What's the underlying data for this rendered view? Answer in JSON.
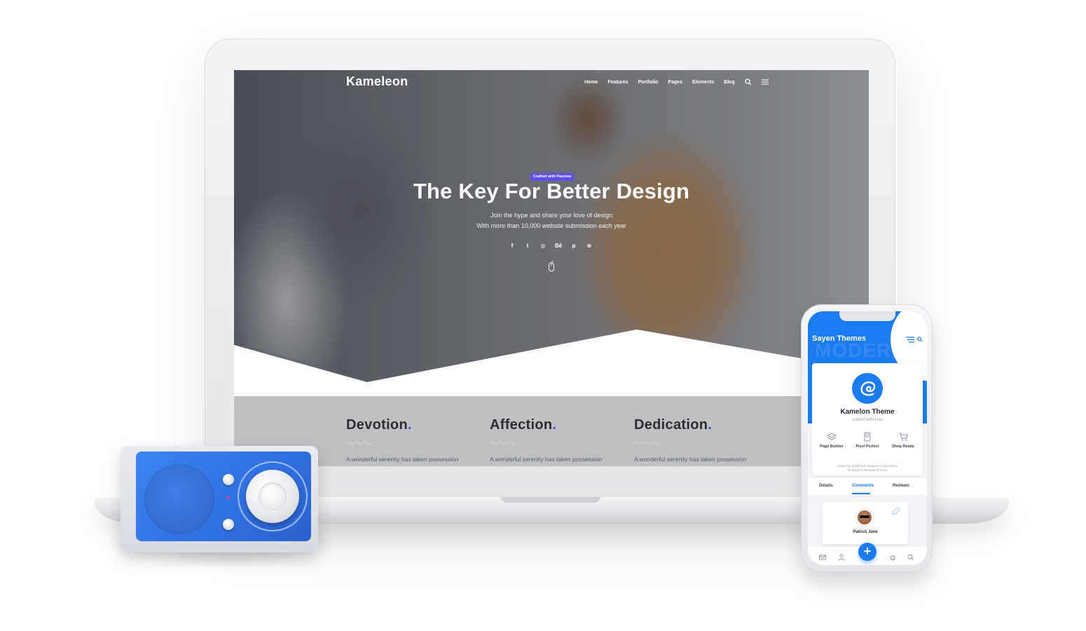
{
  "laptop_site": {
    "logo": "Kameleon",
    "nav": [
      "Home",
      "Features",
      "Portfolio",
      "Pages",
      "Elements",
      "Blog"
    ],
    "hero": {
      "badge": "Crafted with Passion",
      "title": "The Key For Better Design",
      "subtitle_line1": "Join the hype and share your love of design",
      "subtitle_line2": "With more than 10,000 website submission each year",
      "socials": [
        "facebook-icon",
        "twitter-icon",
        "instagram-icon",
        "behance-icon",
        "pinterest-icon",
        "dribbble-icon"
      ],
      "social_glyphs": [
        "f",
        "t",
        "◎",
        "Bē",
        "p",
        "⊛"
      ]
    },
    "features": [
      {
        "title": "Devotion",
        "dot": ".",
        "text": "A wonderful serenity has taken possession"
      },
      {
        "title": "Affection",
        "dot": ".",
        "text": "A wonderful serenity has taken possession"
      },
      {
        "title": "Dedication",
        "dot": ".",
        "text": "A wonderful serenity has taken possession"
      }
    ],
    "accent_color": "#4f46e5"
  },
  "phone_app": {
    "brand": "Sayen Themes",
    "watermark": "MODERN",
    "card": {
      "title": "Kamelon Theme",
      "subtitle": "crafted with love",
      "features": [
        "Page Builder",
        "Pixel Perfect",
        "Shop Ready"
      ],
      "footer_line1": "created by WordPress designers & developers",
      "footer_line2": "for design enthusiasts & lovers"
    },
    "tabs": [
      "Details",
      "Comments",
      "Reviews"
    ],
    "active_tab": "Comments",
    "comment_author": "Patrick Jane",
    "fab_label": "+",
    "accent_color": "#1a7cf0"
  }
}
